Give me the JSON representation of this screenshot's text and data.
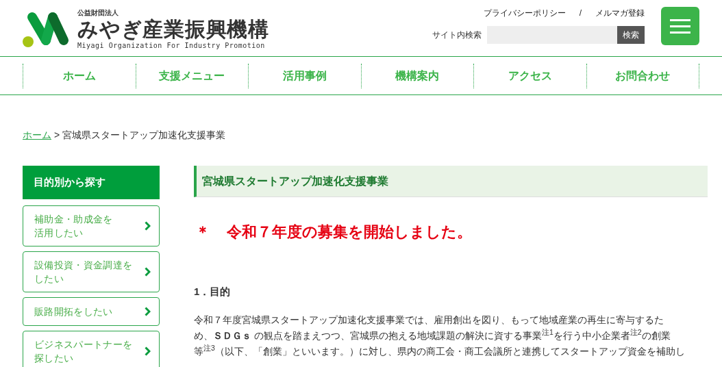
{
  "logo": {
    "caption": "公益財団法人",
    "name": "みやぎ産業振興機構",
    "tagline": "Miyagi Organization For Industry Promotion"
  },
  "top_links": [
    "プライバシーポリシー",
    "メルマガ登録"
  ],
  "top_links_separator": "/",
  "search": {
    "label": "サイト内検索",
    "button": "検索"
  },
  "nav": [
    {
      "label": "ホーム"
    },
    {
      "label": "支援メニュー"
    },
    {
      "label": "活用事例"
    },
    {
      "label": "機構案内"
    },
    {
      "label": "アクセス"
    },
    {
      "label": "お問合わせ"
    }
  ],
  "breadcrumb": {
    "link": "ホーム",
    "separator": ">",
    "current": "宮城県スタートアップ加速化支援事業"
  },
  "sidebar": {
    "heading": "目的別から探す",
    "items": [
      {
        "lines": [
          "補助金・助成金を",
          "活用したい"
        ]
      },
      {
        "lines": [
          "設備投資・資金調達を",
          "したい"
        ]
      },
      {
        "lines": [
          "販路開拓をしたい"
        ]
      },
      {
        "lines": [
          "ビジネスパートナーを",
          "探したい"
        ]
      }
    ]
  },
  "page_title": "宮城県スタートアップ加速化支援事業",
  "notice": {
    "mark": "＊",
    "text": "令和７年度の募集を開始しました。"
  },
  "section_heading": "1．目的",
  "paragraph_lines": [
    "令和７年度宮城県スタートアップ加速化支援事業では、雇用創出を図り、もって地域産業の再生に寄与するた",
    "め、**ＳＤＧｓ** の観点を踏まえつつ、宮城県の抱える地域課題の解決に資する事業$^{注1}$を行う中小企業者$^{注2}$の創業",
    "等$^{注3}$（以下、「創業」といいます。）に対し、県内の商工会・商工会議所と連携してスタートアップ資金を補助し"
  ]
}
